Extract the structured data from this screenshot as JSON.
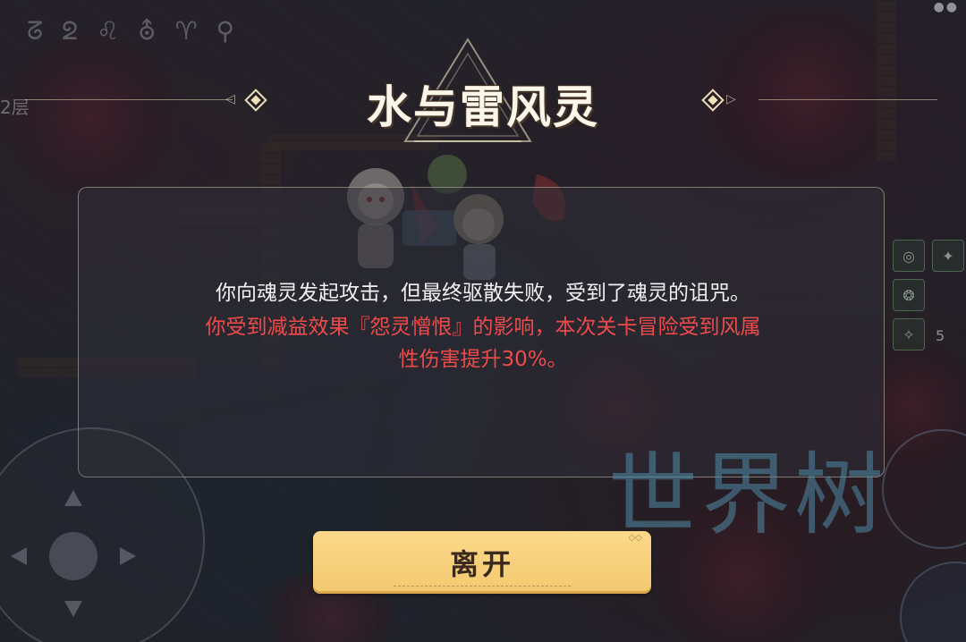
{
  "hud": {
    "top_symbols": "ᘔ ᘖ ♌ ⛢ ♈ ⚲",
    "floor_label": "2层",
    "top_right_dots": "●●"
  },
  "event": {
    "title": "水与雷风灵",
    "message_normal": "你向魂灵发起攻击，但最终驱散失败，受到了魂灵的诅咒。",
    "message_debuff_line1": "你受到减益效果『怨灵憎恨』的影响，本次关卡冒险受到风属",
    "message_debuff_line2": "性伤害提升30%。",
    "leave_button_label": "离开"
  },
  "skills": {
    "count_label": "5"
  },
  "watermark": {
    "text": "世界树"
  },
  "colors": {
    "title_text": "#fbf6ea",
    "debuff_text": "#ef4b4b",
    "button_bg": "#f4c870",
    "button_text": "#3a2a1e",
    "watermark": "#508caa"
  },
  "icons": {
    "left_ornament": "diamond-icon",
    "right_ornament": "diamond-icon",
    "joystick": "joystick-icon"
  }
}
